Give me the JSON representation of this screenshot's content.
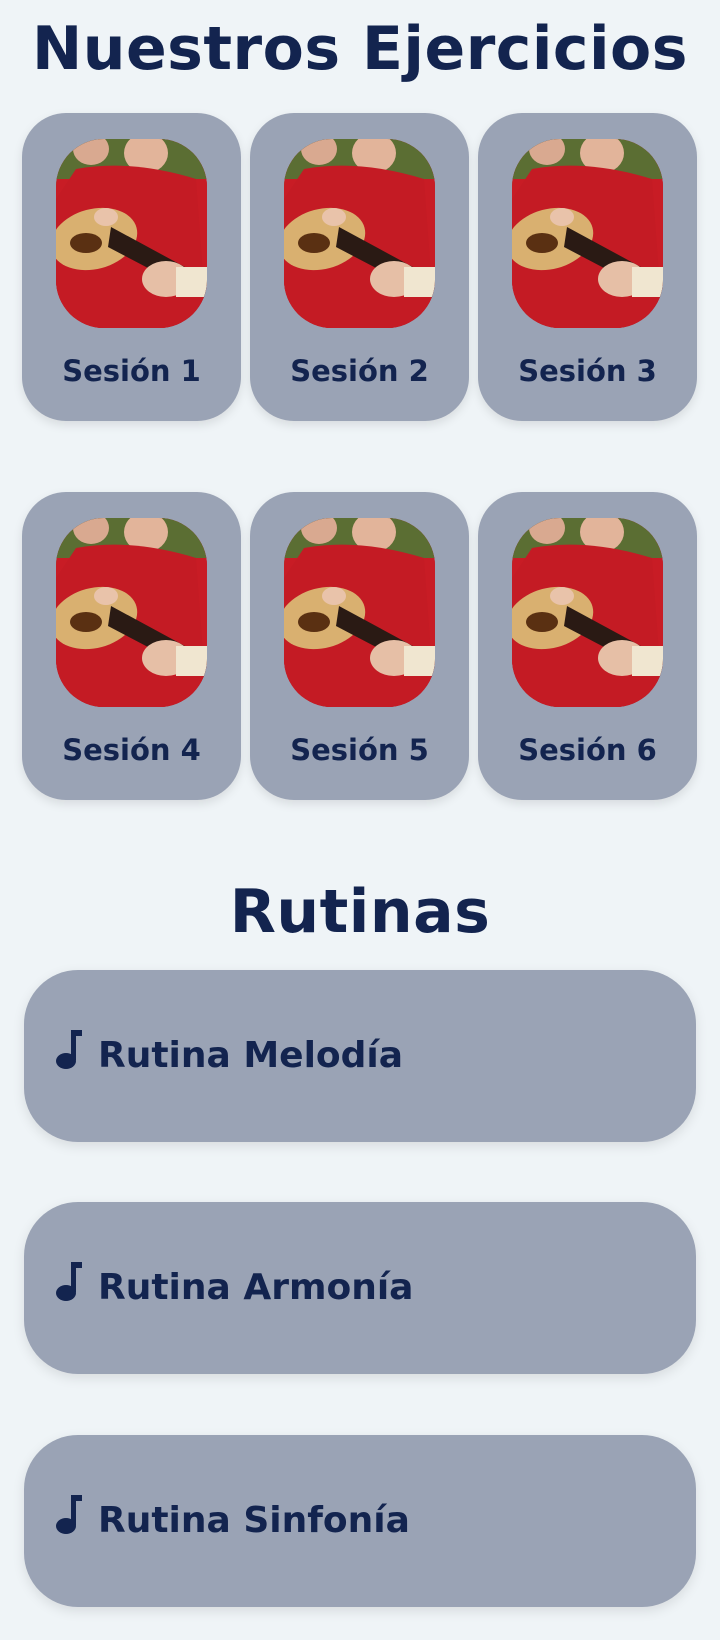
{
  "ejercicios": {
    "title": "Nuestros Ejercicios",
    "sessions": [
      {
        "label": "Sesión 1"
      },
      {
        "label": "Sesión 2"
      },
      {
        "label": "Sesión 3"
      },
      {
        "label": "Sesión 4"
      },
      {
        "label": "Sesión 5"
      },
      {
        "label": "Sesión 6"
      }
    ],
    "photo_icon": "woman-playing-guitar-photo"
  },
  "rutinas": {
    "title": "Rutinas",
    "items": [
      {
        "label": "Rutina Melodía",
        "icon": "music-note-icon"
      },
      {
        "label": "Rutina Armonía",
        "icon": "music-note-icon"
      },
      {
        "label": "Rutina Sinfonía",
        "icon": "music-note-icon"
      }
    ]
  },
  "colors": {
    "background": "#eff4f7",
    "card": "#9aa3b5",
    "text": "#13244f"
  }
}
